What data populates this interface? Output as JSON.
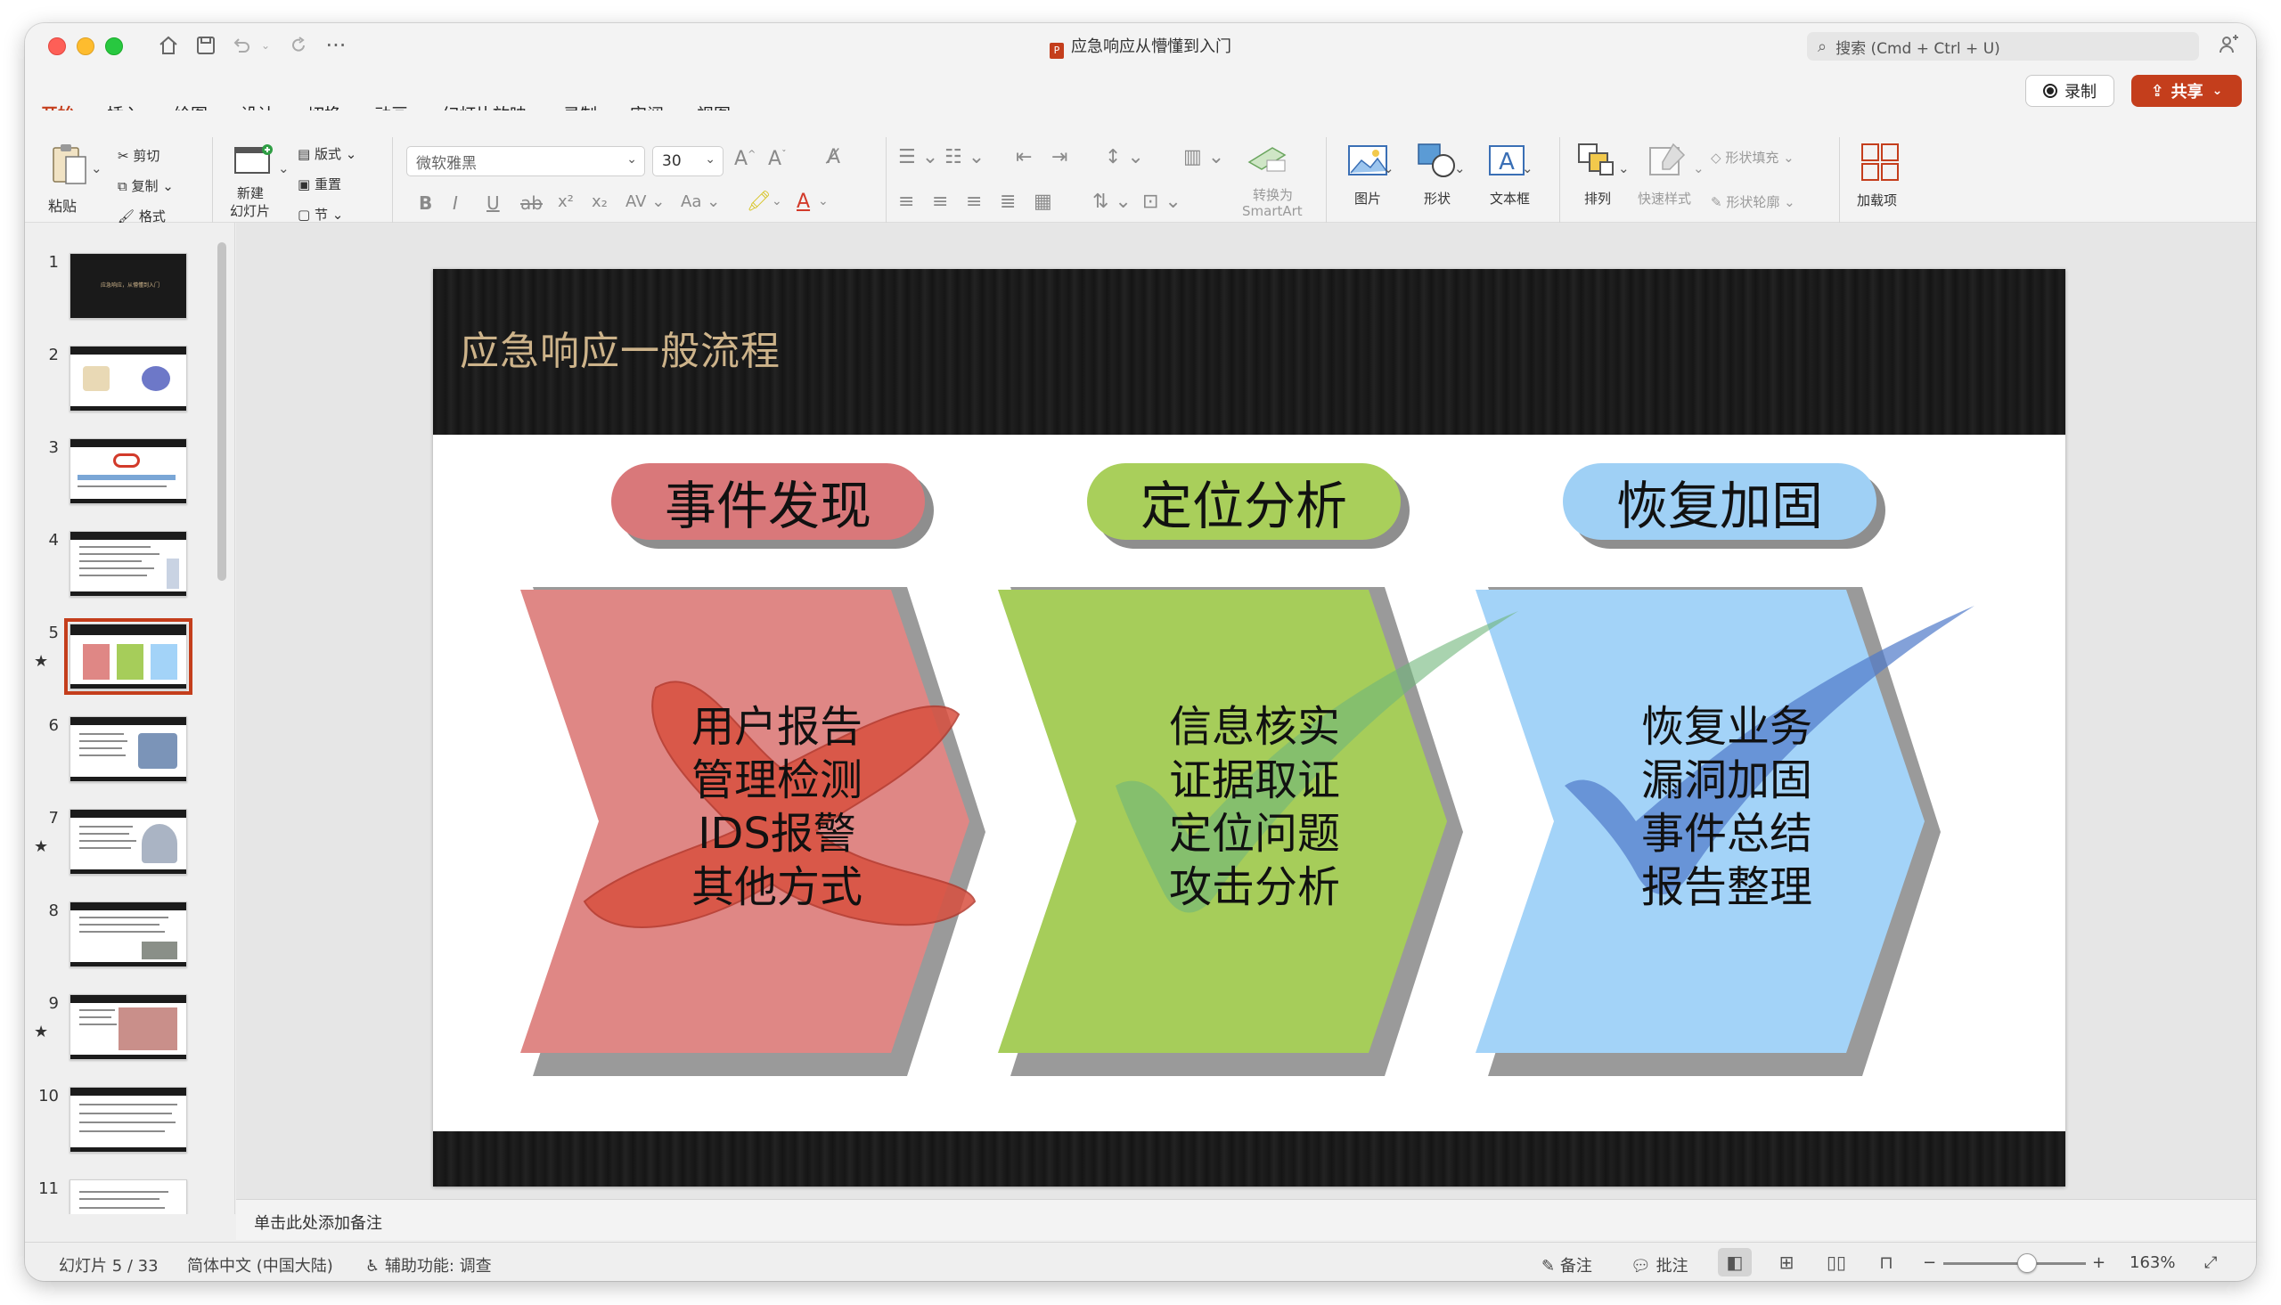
{
  "window": {
    "document_title": "应急响应从懵懂到入门"
  },
  "search": {
    "placeholder": "搜索 (Cmd + Ctrl + U)"
  },
  "tabs": [
    "开始",
    "插入",
    "绘图",
    "设计",
    "切换",
    "动画",
    "幻灯片放映",
    "录制",
    "审阅",
    "视图"
  ],
  "actions": {
    "record": "录制",
    "share": "共享"
  },
  "ribbon": {
    "paste": "粘贴",
    "cut": "剪切",
    "copy": "复制",
    "format": "格式",
    "new_slide_line1": "新建",
    "new_slide_line2": "幻灯片",
    "layout": "版式",
    "reset": "重置",
    "section": "节",
    "font_name": "微软雅黑",
    "font_size": "30",
    "convert_smartart_line1": "转换为",
    "convert_smartart_line2": "SmartArt",
    "picture": "图片",
    "shape": "形状",
    "textbox": "文本框",
    "arrange": "排列",
    "quick_styles": "快速样式",
    "shape_fill": "形状填充",
    "shape_outline": "形状轮廓",
    "addins": "加载项"
  },
  "slides": {
    "numbers": [
      "1",
      "2",
      "3",
      "4",
      "5",
      "6",
      "7",
      "8",
      "9",
      "10",
      "11"
    ],
    "starred_mark": "★",
    "current": 5,
    "thumb1_text": "应急响应，从懵懂到入门"
  },
  "slide": {
    "title": "应急响应一般流程",
    "steps": [
      {
        "label": "事件发现",
        "items": [
          "用户报告",
          "管理检测",
          "IDS报警",
          "其他方式"
        ],
        "pill_color": "#d9787a",
        "body_color": "#df8785"
      },
      {
        "label": "定位分析",
        "items": [
          "信息核实",
          "证据取证",
          "定位问题",
          "攻击分析"
        ],
        "pill_color": "#a9cf5b",
        "body_color": "#a6cd5a"
      },
      {
        "label": "恢复加固",
        "items": [
          "恢复业务",
          "漏洞加固",
          "事件总结",
          "报告整理"
        ],
        "pill_color": "#9fd0f5",
        "body_color": "#a3d3f8"
      }
    ],
    "overlays": [
      "cross-mark",
      "check-mark-green",
      "check-mark-blue"
    ]
  },
  "notes": {
    "placeholder": "单击此处添加备注"
  },
  "status": {
    "slide_counter": "幻灯片 5 / 33",
    "language": "简体中文 (中国大陆)",
    "accessibility": "辅助功能: 调查",
    "notes_btn": "备注",
    "comments_btn": "批注",
    "zoom_minus": "−",
    "zoom_plus": "+",
    "zoom": "163%",
    "zoom_level_percent": 163
  },
  "colors": {
    "accent": "#c43e1c",
    "title_gold": "#cdb38a"
  }
}
